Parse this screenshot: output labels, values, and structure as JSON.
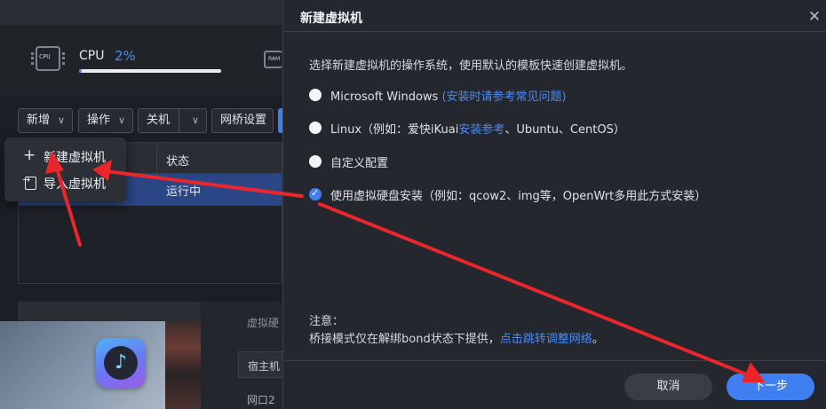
{
  "stats": {
    "cpu_chip_text": "CPU",
    "cpu_label": "CPU",
    "cpu_value": "2%",
    "cpu_progress": 0.02,
    "ram_chip_text": "RAM"
  },
  "toolbar": {
    "new_label": "新增",
    "ops_label": "操作",
    "shutdown_label": "关机",
    "bridge_label": "网桥设置"
  },
  "table": {
    "columns": [
      "状态"
    ],
    "rows": [
      {
        "status": "运行中"
      }
    ]
  },
  "dropdown": {
    "items": [
      {
        "label": "新建虚拟机",
        "icon": "plus-icon"
      },
      {
        "label": "导入虚拟机",
        "icon": "import-icon"
      }
    ]
  },
  "background_panel": {
    "label_a": "虚拟硬",
    "label_b": "宿主机",
    "label_c": "网口2"
  },
  "dialog": {
    "title": "新建虚拟机",
    "description": "选择新建虚拟机的操作系统，使用默认的模板快速创建虚拟机。",
    "options": [
      {
        "label": "Microsoft Windows",
        "link": "(安装时请参考常见问题)",
        "checked": false
      },
      {
        "label": "Linux（例如：爱快iKuai",
        "link": "安装参考",
        "suffix": "、Ubuntu、CentOS）",
        "checked": false
      },
      {
        "label": "自定义配置",
        "checked": false
      },
      {
        "label": "使用虚拟硬盘安装（例如：qcow2、img等，OpenWrt多用此方式安装）",
        "checked": true
      }
    ],
    "note_title": "注意：",
    "note_text": "桥接模式仅在解绑bond状态下提供，",
    "note_link": "点击跳转调整网络",
    "note_end": "。",
    "cancel_label": "取消",
    "next_label": "下一步"
  },
  "colors": {
    "accent": "#3f7ff2",
    "link": "#4d8cf2",
    "annotation_arrow": "#e8262b",
    "selected_row": "#2b4685"
  }
}
